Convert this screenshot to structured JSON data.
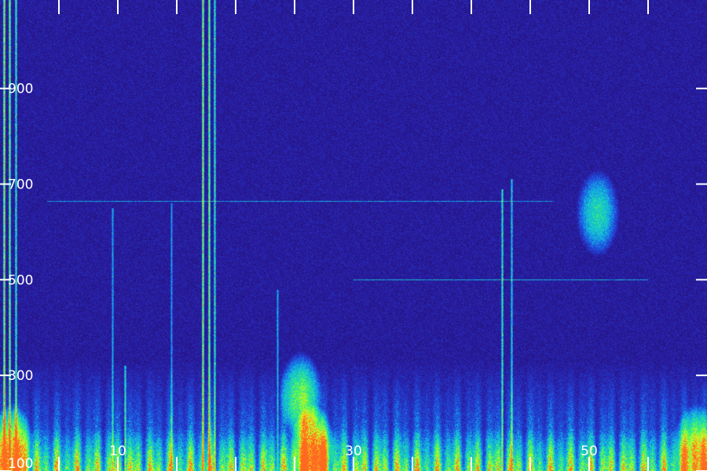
{
  "chart_data": {
    "type": "heatmap",
    "title": "",
    "xlabel": "",
    "ylabel": "",
    "x_tick_labels": [
      {
        "value": 10,
        "label": "10"
      },
      {
        "value": 30,
        "label": "30"
      },
      {
        "value": 50,
        "label": "50"
      }
    ],
    "x_minor_ticks": [
      5,
      10,
      15,
      20,
      25,
      30,
      35,
      40,
      45,
      50,
      55
    ],
    "xlim": [
      0,
      60
    ],
    "y_tick_labels": [
      {
        "value": 100,
        "label": "100"
      },
      {
        "value": 300,
        "label": "300"
      },
      {
        "value": 500,
        "label": "500"
      },
      {
        "value": 700,
        "label": "700"
      },
      {
        "value": 900,
        "label": "900"
      }
    ],
    "ylim": [
      100,
      1085
    ],
    "grid": false,
    "colormap": [
      "#1a0a4a",
      "#2a1aa0",
      "#1f4fe0",
      "#12b4e6",
      "#1fe0a0",
      "#7aff3a",
      "#e8f020",
      "#ff6a20"
    ],
    "background_color": "#1a0a4a",
    "horizontal_lines": [
      {
        "y": 665,
        "x_start": 4,
        "x_end": 47,
        "intensity": 0.35
      },
      {
        "y": 500,
        "x_start": 30,
        "x_end": 55,
        "intensity": 0.4
      }
    ],
    "vertical_streaks": [
      {
        "x": 0.3,
        "y_top": 1085,
        "intensity": 0.95
      },
      {
        "x": 0.8,
        "y_top": 1085,
        "intensity": 0.8
      },
      {
        "x": 1.3,
        "y_top": 1085,
        "intensity": 0.6
      },
      {
        "x": 9.5,
        "y_top": 650,
        "intensity": 0.4
      },
      {
        "x": 10.6,
        "y_top": 320,
        "intensity": 0.55
      },
      {
        "x": 14.5,
        "y_top": 660,
        "intensity": 0.35
      },
      {
        "x": 17.2,
        "y_top": 1085,
        "intensity": 0.9
      },
      {
        "x": 17.7,
        "y_top": 1085,
        "intensity": 0.8
      },
      {
        "x": 18.2,
        "y_top": 1085,
        "intensity": 0.6
      },
      {
        "x": 23.5,
        "y_top": 480,
        "intensity": 0.4
      },
      {
        "x": 42.6,
        "y_top": 690,
        "intensity": 0.6
      },
      {
        "x": 43.4,
        "y_top": 710,
        "intensity": 0.5
      }
    ],
    "energy_bands": [
      {
        "y_low": 100,
        "y_high": 330,
        "intensity": 0.55
      },
      {
        "y_low": 100,
        "y_high": 190,
        "intensity": 0.75
      }
    ],
    "hotspots": [
      {
        "x": 26.5,
        "y": 150,
        "intensity": 0.85
      },
      {
        "x": 25.5,
        "y": 260,
        "intensity": 0.6
      },
      {
        "x": 1.0,
        "y": 150,
        "intensity": 0.7
      },
      {
        "x": 59.0,
        "y": 150,
        "intensity": 0.6
      },
      {
        "x": 50.7,
        "y": 640,
        "intensity": 0.5
      }
    ]
  }
}
